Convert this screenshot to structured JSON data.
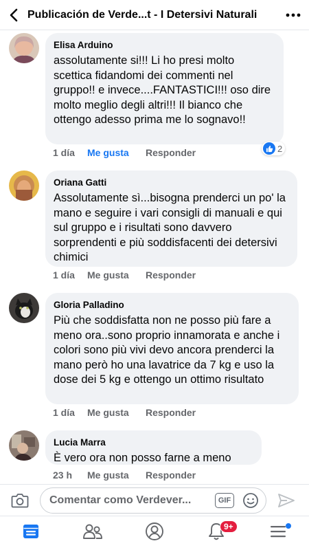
{
  "header": {
    "title": "Publicación de Verde...t -  I Detersivi Naturali"
  },
  "comments": [
    {
      "author": "Elisa Arduino",
      "text": "assolutamente si!!! Li ho presi molto scettica fidandomi dei commenti nel gruppo!! e invece....FANTASTICI!!! oso dire molto meglio degli altri!!! Il bianco che ottengo adesso prima me lo sognavo!!",
      "time": "1 día",
      "like_label": "Me gusta",
      "reply_label": "Responder",
      "liked": true,
      "reaction_count": "2"
    },
    {
      "author": "Oriana Gatti",
      "text": "Assolutamente sì...bisogna prenderci un po' la mano e seguire i vari consigli di manuali e qui sul gruppo e i risultati sono davvero sorprendenti e più soddisfacenti dei detersivi chimici",
      "time": "1 día",
      "like_label": "Me gusta",
      "reply_label": "Responder"
    },
    {
      "author": "Gloria Palladino",
      "text": "Più che soddisfatta non ne posso più fare a meno ora..sono proprio innamorata e anche i colori sono più vivi devo ancora prenderci la mano però ho una lavatrice da 7 kg e uso la dose dei 5 kg e ottengo un ottimo risultato",
      "time": "1 día",
      "like_label": "Me gusta",
      "reply_label": "Responder"
    },
    {
      "author": "Lucia Marra",
      "text": "È  vero ora non posso farne a meno",
      "time": "23 h",
      "like_label": "Me gusta",
      "reply_label": "Responder"
    }
  ],
  "composer": {
    "placeholder": "Comentar como Verdever...",
    "gif_label": "GIF"
  },
  "nav": {
    "notifications_badge": "9+"
  },
  "colors": {
    "accent": "#1877f2",
    "bubble": "#f0f2f5",
    "meta": "#65676b",
    "badge": "#e41e3f"
  },
  "icons": [
    "back-arrow-icon",
    "more-icon",
    "thumbs-up-icon",
    "camera-icon",
    "smile-icon",
    "send-icon",
    "feed-icon",
    "groups-icon",
    "profile-icon",
    "bell-icon",
    "menu-icon"
  ]
}
